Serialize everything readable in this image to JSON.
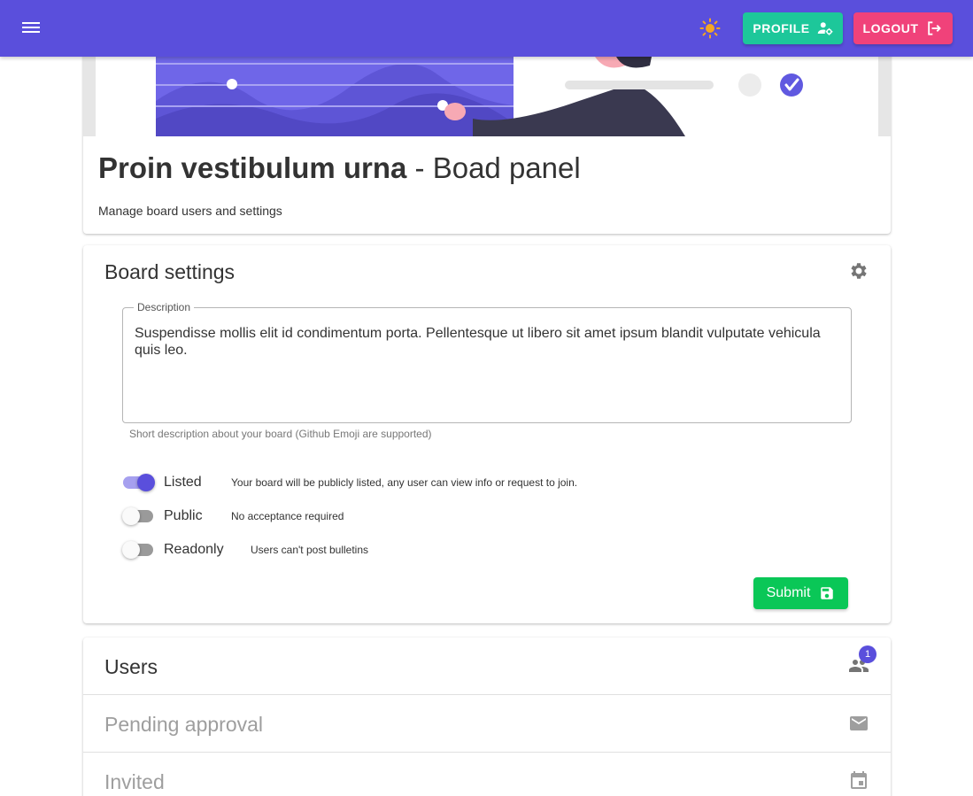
{
  "appbar": {
    "profile_label": "PROFILE",
    "logout_label": "LOGOUT",
    "background": "#5a4fdc",
    "sun_color": "#f5a623"
  },
  "header": {
    "title_bold": "Proin vestibulum urna",
    "title_rest": " - Boad panel",
    "subtitle": "Manage board users and settings"
  },
  "settings": {
    "title": "Board settings",
    "description_label": "Description",
    "description_value": "Suspendisse mollis elit id condimentum porta. Pellentesque ut libero sit amet ipsum blandit vulputate vehicula quis leo.",
    "description_hint": "Short description about your board (Github Emoji are supported)",
    "toggles": [
      {
        "label": "Listed",
        "description": "Your board will be publicly listed, any user can view info or request to join.",
        "on": true
      },
      {
        "label": "Public",
        "description": "No acceptance required",
        "on": false
      },
      {
        "label": "Readonly",
        "description": "Users can't post bulletins",
        "on": false
      }
    ],
    "submit_label": "Submit"
  },
  "panels": {
    "users": {
      "title": "Users",
      "badge": "1",
      "icon": "people-icon"
    },
    "pending": {
      "title": "Pending approval",
      "icon": "mail-icon"
    },
    "invited": {
      "title": "Invited",
      "icon": "calendar-icon"
    }
  },
  "colors": {
    "primary": "#5a4fdc",
    "profile_button": "#1dc79a",
    "logout_button": "#f0427a",
    "submit_button": "#0ac757"
  }
}
